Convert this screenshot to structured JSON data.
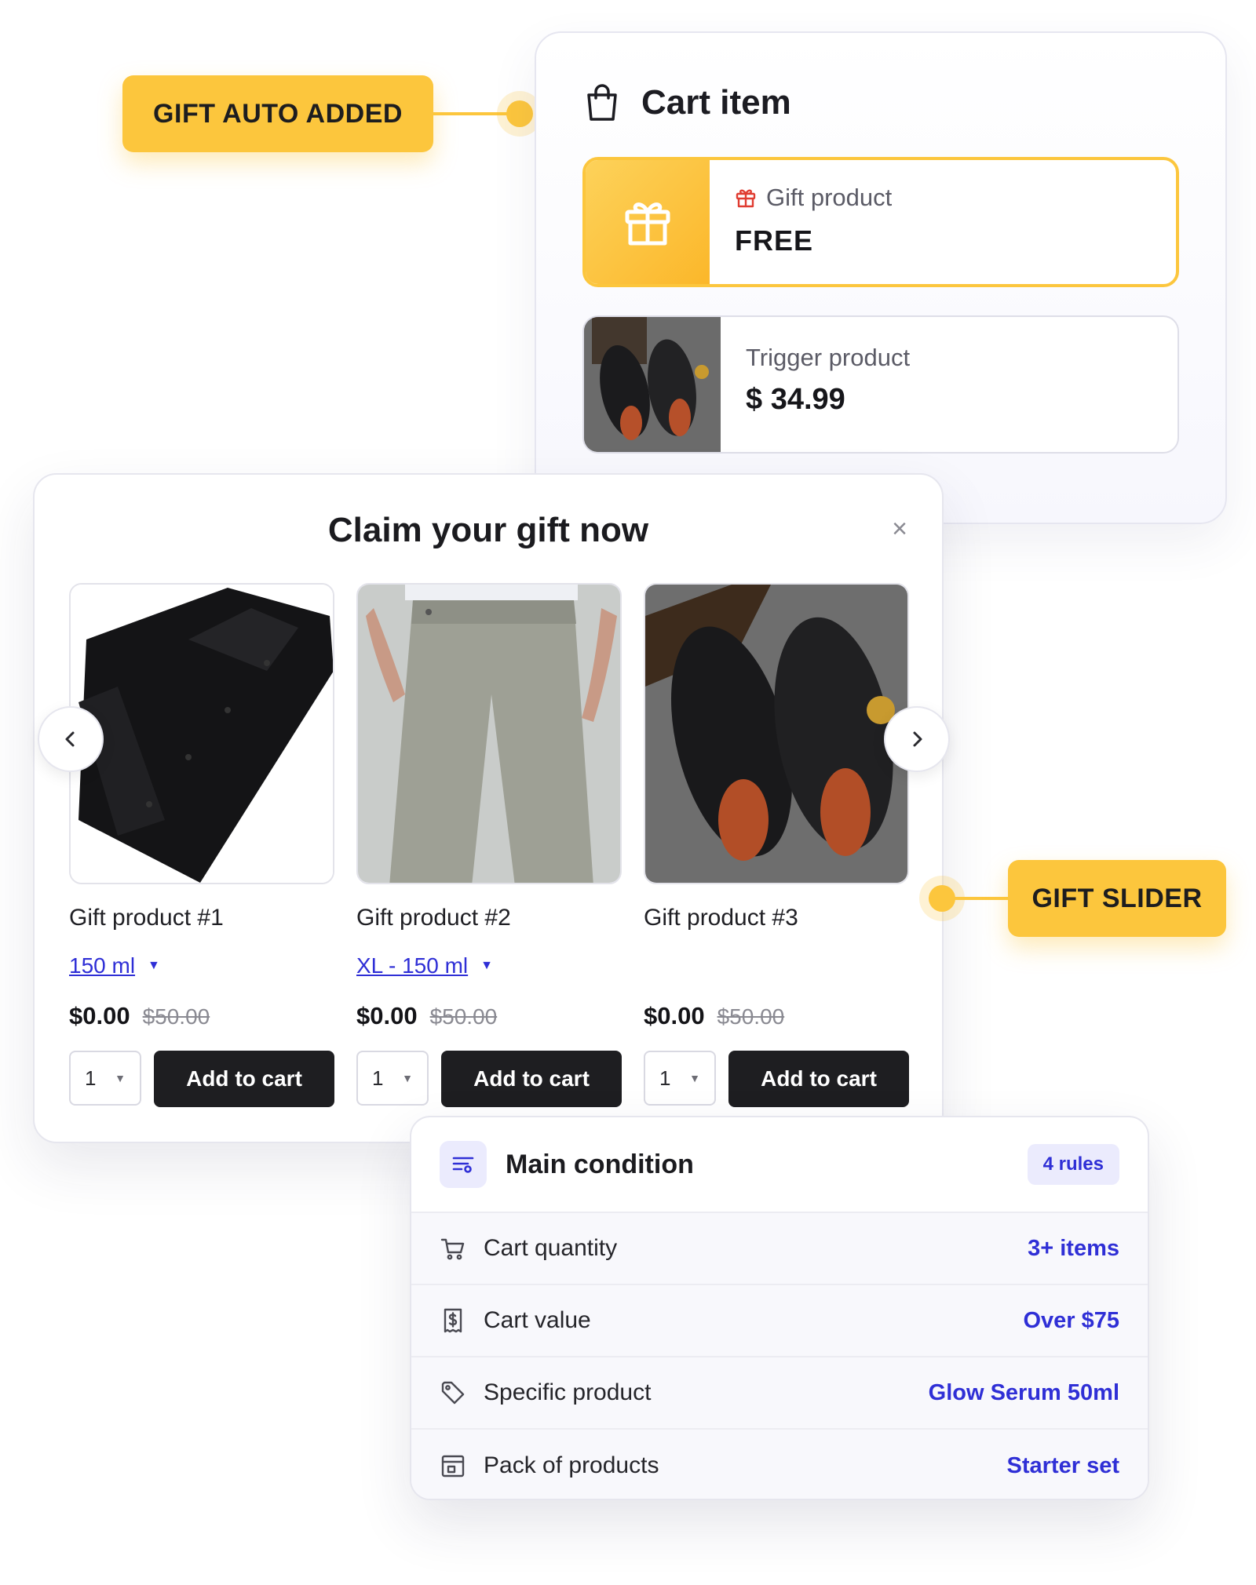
{
  "callouts": {
    "auto_added": "GIFT AUTO ADDED",
    "slider": "GIFT SLIDER"
  },
  "cart": {
    "title": "Cart item",
    "gift": {
      "label": "Gift product",
      "price": "FREE"
    },
    "trigger": {
      "label": "Trigger product",
      "price": "$ 34.99"
    }
  },
  "modal": {
    "title": "Claim your gift now",
    "close": "×",
    "products": [
      {
        "name": "Gift product #1",
        "variant": "150 ml",
        "price": "$0.00",
        "compare_price": "$50.00",
        "qty": "1",
        "button": "Add to cart"
      },
      {
        "name": "Gift product #2",
        "variant": "XL - 150 ml",
        "price": "$0.00",
        "compare_price": "$50.00",
        "qty": "1",
        "button": "Add to cart"
      },
      {
        "name": "Gift product #3",
        "variant": "",
        "price": "$0.00",
        "compare_price": "$50.00",
        "qty": "1",
        "button": "Add to cart"
      }
    ]
  },
  "condition": {
    "title": "Main condition",
    "badge": "4 rules",
    "rules": [
      {
        "icon": "cart-icon",
        "label": "Cart quantity",
        "value": "3+ items"
      },
      {
        "icon": "receipt-dollar-icon",
        "label": "Cart value",
        "value": "Over $75"
      },
      {
        "icon": "tag-icon",
        "label": "Specific product",
        "value": "Glow Serum 50ml"
      },
      {
        "icon": "package-icon",
        "label": "Pack of products",
        "value": "Starter set"
      }
    ]
  },
  "colors": {
    "accent_yellow": "#fcc63d",
    "link_blue": "#2f2fd6",
    "button_dark": "#1e1e21"
  }
}
